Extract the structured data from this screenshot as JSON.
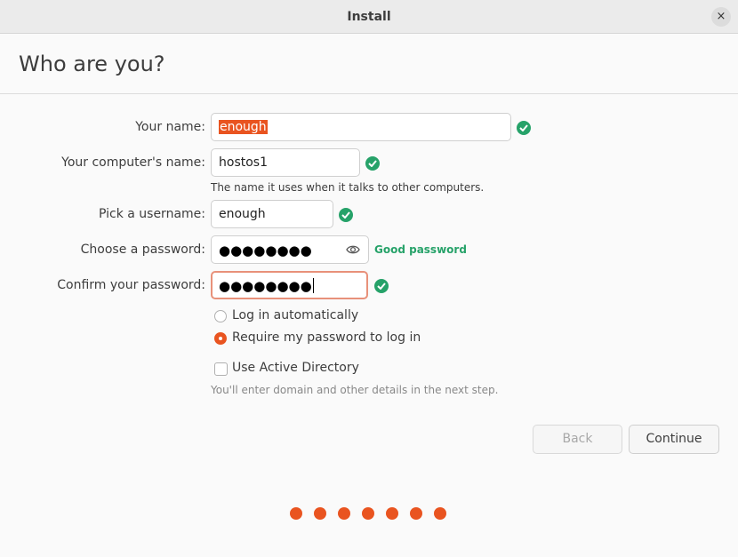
{
  "window": {
    "title": "Install",
    "close_glyph": "×"
  },
  "page": {
    "heading": "Who are you?"
  },
  "form": {
    "name": {
      "label": "Your name:",
      "value": "enough"
    },
    "computer": {
      "label": "Your computer's name:",
      "value": "hostos1",
      "hint": "The name it uses when it talks to other computers."
    },
    "username": {
      "label": "Pick a username:",
      "value": "enough"
    },
    "password": {
      "label": "Choose a password:",
      "masked": "●●●●●●●●",
      "strength": "Good password"
    },
    "confirm": {
      "label": "Confirm your password:",
      "masked": "●●●●●●●●"
    },
    "login_options": [
      {
        "label": "Log in automatically",
        "selected": false
      },
      {
        "label": "Require my password to log in",
        "selected": true
      }
    ],
    "active_directory": {
      "label": "Use Active Directory",
      "checked": false,
      "hint": "You'll enter domain and other details in the next step."
    }
  },
  "buttons": {
    "back": "Back",
    "continue": "Continue"
  },
  "progress": {
    "completed_steps": 7
  },
  "colors": {
    "accent": "#e95420",
    "success": "#26a269"
  },
  "icons": {
    "valid": "check-circle-icon",
    "reveal": "eye-icon",
    "close": "close-icon"
  }
}
